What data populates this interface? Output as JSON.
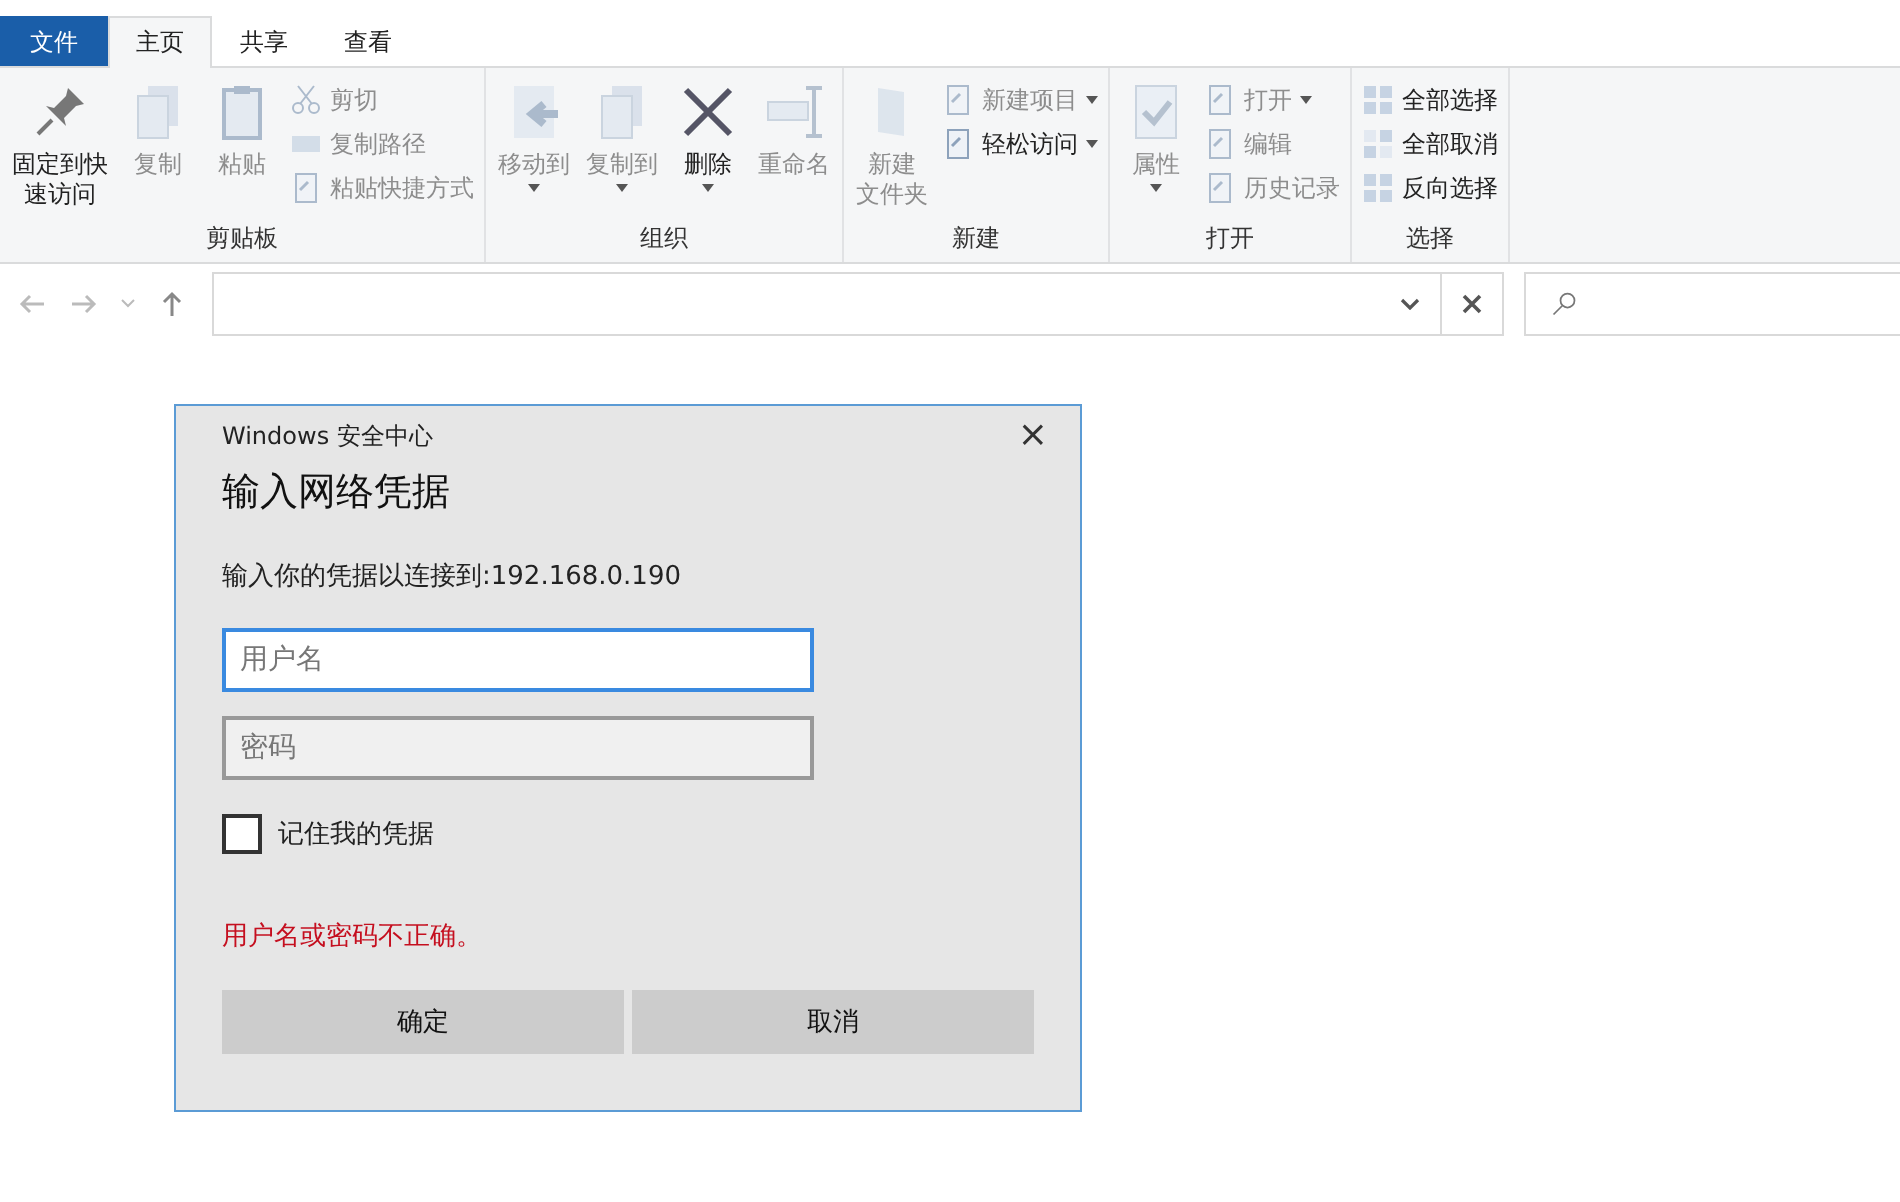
{
  "tabs": [
    {
      "label": "文件",
      "kind": "file",
      "selected": false
    },
    {
      "label": "主页",
      "kind": "tab",
      "selected": true
    },
    {
      "label": "共享",
      "kind": "tab",
      "selected": false
    },
    {
      "label": "查看",
      "kind": "tab",
      "selected": false
    }
  ],
  "ribbon": [
    {
      "label": "剪贴板",
      "large": [
        {
          "label": "固定到快速访问",
          "kind": "pin",
          "disabled": false,
          "dropdown": false
        },
        {
          "label": "复制",
          "kind": "copy",
          "disabled": true,
          "dropdown": false
        },
        {
          "label": "粘贴",
          "kind": "paste",
          "disabled": true,
          "dropdown": false
        }
      ],
      "small": [
        {
          "label": "剪切",
          "kind": "cut",
          "disabled": true,
          "dropdown": false
        },
        {
          "label": "复制路径",
          "kind": "path",
          "disabled": true,
          "dropdown": false
        },
        {
          "label": "粘贴快捷方式",
          "kind": "shortcut",
          "disabled": true,
          "dropdown": false
        }
      ]
    },
    {
      "label": "组织",
      "large": [
        {
          "label": "移动到",
          "kind": "move",
          "disabled": true,
          "dropdown": true
        },
        {
          "label": "复制到",
          "kind": "copyto",
          "disabled": true,
          "dropdown": true
        },
        {
          "label": "删除",
          "kind": "delete",
          "disabled": false,
          "dropdown": true
        },
        {
          "label": "重命名",
          "kind": "rename",
          "disabled": true,
          "dropdown": false
        }
      ]
    },
    {
      "label": "新建",
      "large": [
        {
          "label": "新建文件夹",
          "kind": "folder",
          "disabled": true,
          "dropdown": false
        }
      ],
      "small": [
        {
          "label": "新建项目",
          "kind": "newitem",
          "disabled": true,
          "dropdown": true
        },
        {
          "label": "轻松访问",
          "kind": "easy",
          "disabled": false,
          "dropdown": true
        }
      ]
    },
    {
      "label": "打开",
      "large": [
        {
          "label": "属性",
          "kind": "props",
          "disabled": true,
          "dropdown": true
        }
      ],
      "small": [
        {
          "label": "打开",
          "kind": "open",
          "disabled": true,
          "dropdown": true
        },
        {
          "label": "编辑",
          "kind": "edit",
          "disabled": true,
          "dropdown": false
        },
        {
          "label": "历史记录",
          "kind": "history",
          "disabled": true,
          "dropdown": false
        }
      ]
    },
    {
      "label": "选择",
      "small": [
        {
          "label": "全部选择",
          "kind": "selall",
          "disabled": false,
          "dropdown": false
        },
        {
          "label": "全部取消",
          "kind": "selnone",
          "disabled": false,
          "dropdown": false
        },
        {
          "label": "反向选择",
          "kind": "invert",
          "disabled": false,
          "dropdown": false
        }
      ]
    }
  ],
  "dialog": {
    "caption": "Windows 安全中心",
    "close": "×",
    "heading": "输入网络凭据",
    "prompt": "输入你的凭据以连接到:192.168.0.190",
    "fields": [
      {
        "placeholder": "用户名",
        "focused": true
      },
      {
        "placeholder": "密码",
        "focused": false
      }
    ],
    "remember": {
      "label": "记住我的凭据",
      "checked": false
    },
    "error": "用户名或密码不正确。",
    "buttons": [
      {
        "label": "确定"
      },
      {
        "label": "取消"
      }
    ]
  }
}
